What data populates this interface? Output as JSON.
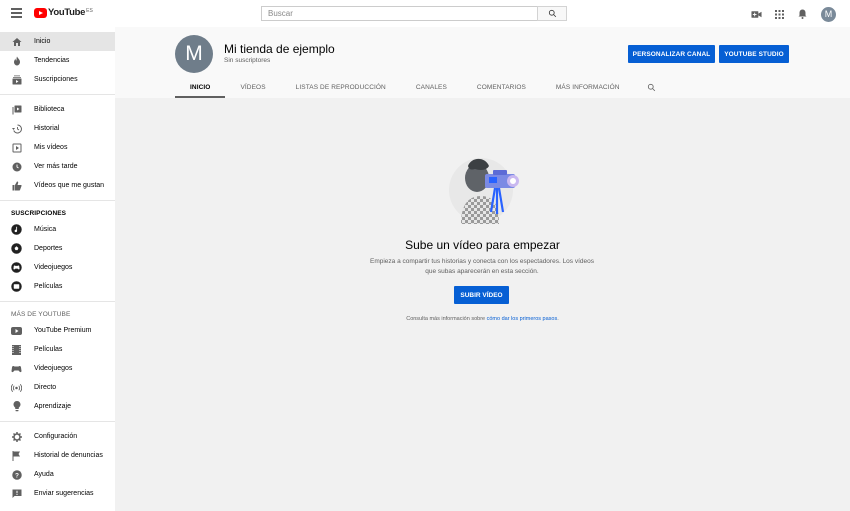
{
  "app": {
    "logo_text": "YouTube",
    "logo_region": "ES"
  },
  "search": {
    "placeholder": "Buscar"
  },
  "sidebar": {
    "main_items": [
      {
        "label": "Inicio",
        "icon": "home-icon"
      },
      {
        "label": "Tendencias",
        "icon": "flame-icon"
      },
      {
        "label": "Suscripciones",
        "icon": "subscriptions-icon"
      }
    ],
    "library_items": [
      {
        "label": "Biblioteca",
        "icon": "library-icon"
      },
      {
        "label": "Historial",
        "icon": "history-icon"
      },
      {
        "label": "Mis vídeos",
        "icon": "my-videos-icon"
      },
      {
        "label": "Ver más tarde",
        "icon": "watch-later-icon"
      },
      {
        "label": "Vídeos que me gustan",
        "icon": "thumbs-up-icon"
      }
    ],
    "subscriptions_header": "SUSCRIPCIONES",
    "subscription_items": [
      {
        "label": "Música",
        "icon": "music-icon"
      },
      {
        "label": "Deportes",
        "icon": "sports-icon"
      },
      {
        "label": "Videojuegos",
        "icon": "gaming-icon"
      },
      {
        "label": "Películas",
        "icon": "movies-icon"
      }
    ],
    "more_header": "MÁS DE YOUTUBE",
    "more_items": [
      {
        "label": "YouTube Premium",
        "icon": "youtube-premium-icon"
      },
      {
        "label": "Películas",
        "icon": "film-icon"
      },
      {
        "label": "Videojuegos",
        "icon": "controller-icon"
      },
      {
        "label": "Directo",
        "icon": "live-icon"
      },
      {
        "label": "Aprendizaje",
        "icon": "lightbulb-icon"
      }
    ],
    "settings_items": [
      {
        "label": "Configuración",
        "icon": "gear-icon"
      },
      {
        "label": "Historial de denuncias",
        "icon": "flag-icon"
      },
      {
        "label": "Ayuda",
        "icon": "help-icon"
      },
      {
        "label": "Enviar sugerencias",
        "icon": "feedback-icon"
      }
    ]
  },
  "channel": {
    "avatar_letter": "M",
    "name": "Mi tienda de ejemplo",
    "subscribers": "Sin suscriptores",
    "customize_label": "PERSONALIZAR CANAL",
    "studio_label": "YOUTUBE STUDIO",
    "tabs": [
      {
        "label": "INICIO",
        "active": true
      },
      {
        "label": "VÍDEOS",
        "active": false
      },
      {
        "label": "LISTAS DE REPRODUCCIÓN",
        "active": false
      },
      {
        "label": "CANALES",
        "active": false
      },
      {
        "label": "COMENTARIOS",
        "active": false
      },
      {
        "label": "MÁS INFORMACIÓN",
        "active": false
      }
    ]
  },
  "empty_state": {
    "title": "Sube un vídeo para empezar",
    "description": "Empieza a compartir tus historias y conecta con los espectadores. Los vídeos que subas aparecerán en esta sección.",
    "upload_label": "SUBIR VÍDEO",
    "help_prefix": "Consulta más información sobre ",
    "help_link": "cómo dar los primeros pasos",
    "help_suffix": "."
  },
  "user": {
    "avatar_letter": "M"
  },
  "colors": {
    "accent": "#065fd4",
    "logo_red": "#ff0000",
    "avatar": "#6f7d8a"
  }
}
